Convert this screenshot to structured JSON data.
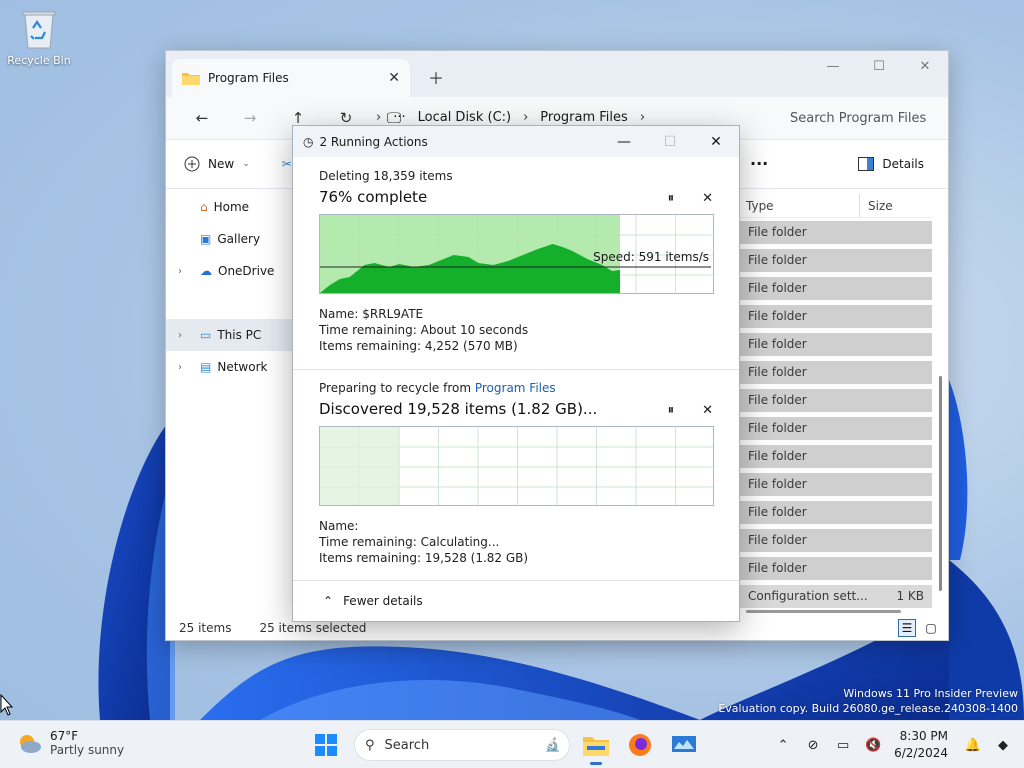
{
  "desktop": {
    "recycle_bin_label": "Recycle Bin",
    "watermark_line1": "Windows 11 Pro Insider Preview",
    "watermark_line2": "Evaluation copy. Build 26080.ge_release.240308-1400"
  },
  "explorer": {
    "tab_title": "Program Files",
    "new_tab_icon": "plus-icon",
    "breadcrumbs": [
      "Local Disk (C:)",
      "Program Files"
    ],
    "search_placeholder": "Search Program Files",
    "new_label": "New",
    "details_label": "Details",
    "nav_items": [
      {
        "label": "Home",
        "icon": "home-icon"
      },
      {
        "label": "Gallery",
        "icon": "gallery-icon"
      },
      {
        "label": "OneDrive",
        "icon": "cloud-icon"
      },
      {
        "label": "This PC",
        "icon": "pc-icon"
      },
      {
        "label": "Network",
        "icon": "network-icon"
      }
    ],
    "columns": {
      "type": "Type",
      "size": "Size"
    },
    "rows": [
      {
        "type": "File folder",
        "size": ""
      },
      {
        "type": "File folder",
        "size": ""
      },
      {
        "type": "File folder",
        "size": ""
      },
      {
        "type": "File folder",
        "size": ""
      },
      {
        "type": "File folder",
        "size": ""
      },
      {
        "type": "File folder",
        "size": ""
      },
      {
        "type": "File folder",
        "size": ""
      },
      {
        "type": "File folder",
        "size": ""
      },
      {
        "type": "File folder",
        "size": ""
      },
      {
        "type": "File folder",
        "size": ""
      },
      {
        "type": "File folder",
        "size": ""
      },
      {
        "type": "File folder",
        "size": ""
      },
      {
        "type": "File folder",
        "size": ""
      },
      {
        "type": "Configuration sett...",
        "size": "1 KB"
      }
    ],
    "status_items": "25 items",
    "status_selected": "25 items selected"
  },
  "dialog": {
    "title": "2 Running Actions",
    "action1": {
      "line1": "Deleting 18,359 items",
      "line2": "76% complete",
      "progress": 0.76,
      "speed": "Speed: 591 items/s",
      "name_label": "Name:",
      "name_value": "$RRL9ATE",
      "time_label": "Time remaining:",
      "time_value": "About 10 seconds",
      "items_label": "Items remaining:",
      "items_value": "4,252 (570 MB)"
    },
    "action2": {
      "line1_prefix": "Preparing to recycle from",
      "line1_link": "Program Files",
      "line2": "Discovered 19,528 items (1.82 GB)...",
      "progress": 0.0,
      "name_label": "Name:",
      "name_value": "",
      "time_label": "Time remaining:",
      "time_value": "Calculating...",
      "items_label": "Items remaining:",
      "items_value": "19,528 (1.82 GB)"
    },
    "fewer_details": "Fewer details"
  },
  "taskbar": {
    "weather_temp": "67°F",
    "weather_desc": "Partly sunny",
    "search_label": "Search",
    "time": "8:30 PM",
    "date": "6/2/2024"
  },
  "colors": {
    "accent": "#2f6fd1",
    "graph_fill_light": "#a8e6a0",
    "graph_fill_dark": "#14b02c",
    "link": "#1f5fa8"
  }
}
